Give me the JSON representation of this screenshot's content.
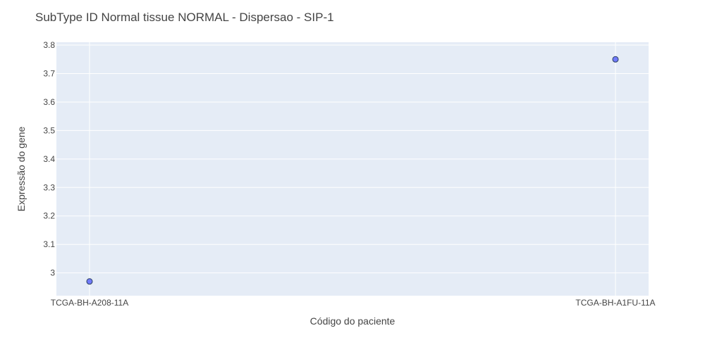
{
  "chart_data": {
    "type": "scatter",
    "title": "SubType ID Normal tissue NORMAL - Dispersao - SIP-1",
    "xlabel": "Código do paciente",
    "ylabel": "Expressão do gene",
    "categories": [
      "TCGA-BH-A208-11A",
      "TCGA-BH-A1FU-11A"
    ],
    "series": [
      {
        "values": [
          2.97,
          3.75
        ]
      }
    ],
    "ylim": [
      2.92,
      3.81
    ],
    "yticks": [
      3,
      3.1,
      3.2,
      3.3,
      3.4,
      3.5,
      3.6,
      3.7,
      3.8
    ],
    "ytick_labels": [
      "3",
      "3.1",
      "3.2",
      "3.3",
      "3.4",
      "3.5",
      "3.6",
      "3.7",
      "3.8"
    ],
    "grid": true,
    "legend": "none"
  },
  "colors": {
    "plot_bg": "#e5ecf6",
    "grid": "#ffffff",
    "marker_fill": "#636efa",
    "marker_stroke": "#2a3f5f",
    "text": "#444444"
  }
}
